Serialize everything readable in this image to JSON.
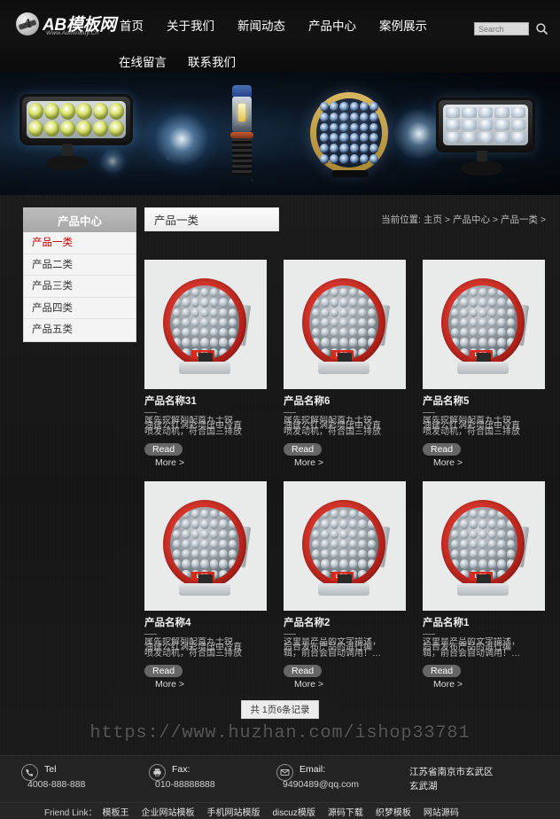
{
  "site": {
    "logo_text": "AB模板网",
    "logo_sub": "Www.AdminBuy.Cn",
    "logo_mark": "A"
  },
  "nav": {
    "row1": [
      {
        "label": "首页"
      },
      {
        "label": "关于我们"
      },
      {
        "label": "新闻动态"
      },
      {
        "label": "产品中心"
      },
      {
        "label": "案例展示"
      }
    ],
    "row2": [
      {
        "label": "在线留言"
      },
      {
        "label": "联系我们"
      }
    ]
  },
  "search": {
    "placeholder": "Search",
    "value": "",
    "icon": "search-icon"
  },
  "sidebar": {
    "title": "产品中心",
    "items": [
      {
        "label": "产品一类",
        "active": true
      },
      {
        "label": "产品二类",
        "active": false
      },
      {
        "label": "产品三类",
        "active": false
      },
      {
        "label": "产品四类",
        "active": false
      },
      {
        "label": "产品五类",
        "active": false
      }
    ]
  },
  "main": {
    "page_title": "产品一类",
    "breadcrumb": "当前位置: 主页 > 产品中心 > 产品一类 >",
    "products": [
      {
        "name": "产品名称31",
        "desc_line1": "属先挖解列配首九士锐",
        "desc_line2": "油建公红涡彩增压中冷直",
        "desc_line3": "喷发动机，符合国三排放",
        "read": "Read",
        "more": "More >",
        "image": "red-round-led-work-light",
        "badge": "LED"
      },
      {
        "name": "产品名称6",
        "desc_line1": "属先挖解列配首九士锐",
        "desc_line2": "油建公红涡彩增压中冷直",
        "desc_line3": "喷发动机，符合国三排放",
        "read": "Read",
        "more": "More >",
        "image": "red-round-led-work-light",
        "badge": "LED"
      },
      {
        "name": "产品名称5",
        "desc_line1": "属先挖解列配首九士锐",
        "desc_line2": "油建公红涡彩增压中冷直",
        "desc_line3": "喷发动机，符合国三排放",
        "read": "Read",
        "more": "More >",
        "image": "red-round-led-work-light",
        "badge": "LED"
      },
      {
        "name": "产品名称4",
        "desc_line1": "属先挖解列配首九士锐",
        "desc_line2": "油建公红涡彩增压中冷直",
        "desc_line3": "喷发动机，符合国三排放",
        "read": "Read",
        "more": "More >",
        "image": "red-round-led-work-light",
        "badge": "LED"
      },
      {
        "name": "产品名称2",
        "desc_line1": "这里是产品的文字描述，",
        "desc_line2": "后台发布产品的进行编",
        "desc_line3": "辑，前台会自动调用！…",
        "read": "Read",
        "more": "More >",
        "image": "red-round-led-work-light",
        "badge": "LED"
      },
      {
        "name": "产品名称1",
        "desc_line1": "这里是产品的文字描述，",
        "desc_line2": "后台发布产品的进行编",
        "desc_line3": "辑，前台会自动调用！…",
        "read": "Read",
        "more": "More >",
        "image": "red-round-led-work-light",
        "badge": "LED"
      }
    ],
    "pagination": "共 1页6条记录"
  },
  "watermark": "https://www.huzhan.com/ishop33781",
  "footer": {
    "tel": {
      "label": "Tel",
      "value": "4008-888-888",
      "icon": "phone-icon"
    },
    "fax": {
      "label": "Fax:",
      "value": "010-88888888",
      "icon": "printer-icon"
    },
    "email": {
      "label": "Email:",
      "value": "9490489@qq.com",
      "icon": "mail-icon"
    },
    "address_line1": "江苏省南京市玄武区",
    "address_line2": "玄武湖",
    "friend_label": "Friend Link：",
    "friend_links": [
      {
        "label": "模板王"
      },
      {
        "label": "企业网站模板"
      },
      {
        "label": "手机网站模版"
      },
      {
        "label": "discuz模版"
      },
      {
        "label": "源码下载"
      },
      {
        "label": "织梦模板"
      },
      {
        "label": "网站源码"
      }
    ]
  },
  "colors": {
    "accent_red": "#c00000",
    "header_bg": "#0e0e0e",
    "page_bg": "#1a1a1a",
    "footer_bg": "#232323"
  }
}
